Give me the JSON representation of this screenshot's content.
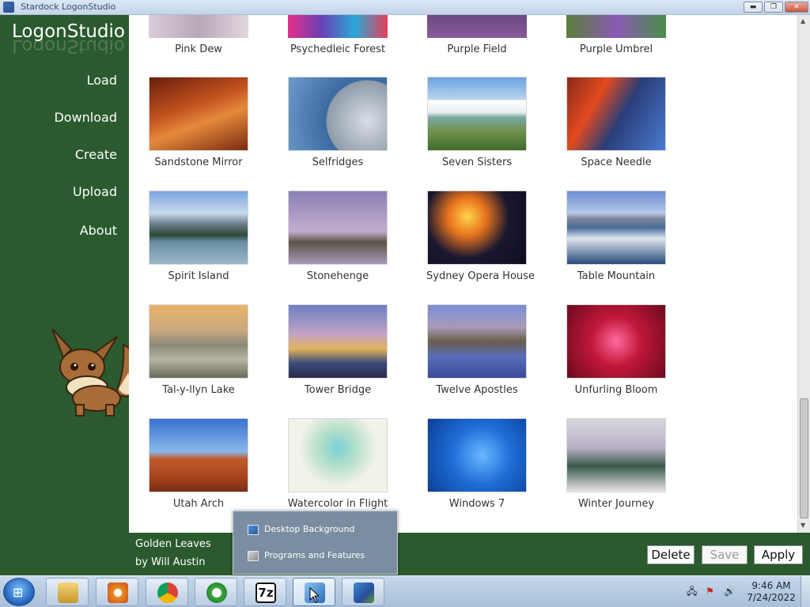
{
  "window": {
    "title": "Stardock LogonStudio",
    "min": "▬",
    "max": "❐",
    "close": "✕"
  },
  "sidebar": {
    "app_title": "LogonStudio",
    "nav": [
      {
        "label": "Load"
      },
      {
        "label": "Download"
      },
      {
        "label": "Create"
      },
      {
        "label": "Upload"
      },
      {
        "label": "About"
      }
    ]
  },
  "gallery": {
    "top_row": [
      {
        "label": "Pink Dew"
      },
      {
        "label": "Psychedleic Forest"
      },
      {
        "label": "Purple Field"
      },
      {
        "label": "Purple Umbrel"
      }
    ],
    "rows": [
      [
        {
          "label": "Sandstone Mirror"
        },
        {
          "label": "Selfridges"
        },
        {
          "label": "Seven Sisters"
        },
        {
          "label": "Space Needle"
        }
      ],
      [
        {
          "label": "Spirit Island"
        },
        {
          "label": "Stonehenge"
        },
        {
          "label": "Sydney Opera House"
        },
        {
          "label": "Table Mountain"
        }
      ],
      [
        {
          "label": "Tal-y-llyn Lake"
        },
        {
          "label": "Tower Bridge"
        },
        {
          "label": "Twelve Apostles"
        },
        {
          "label": "Unfurling Bloom"
        }
      ],
      [
        {
          "label": "Utah Arch"
        },
        {
          "label": "Watercolor in Flight"
        },
        {
          "label": "Windows 7"
        },
        {
          "label": "Winter Journey"
        }
      ]
    ]
  },
  "selection": {
    "name": "Golden Leaves",
    "author": "by Will Austin"
  },
  "buttons": {
    "delete": "Delete",
    "save": "Save",
    "apply": "Apply"
  },
  "popup": {
    "items": [
      {
        "label": "Desktop Background"
      },
      {
        "label": "Programs and Features"
      }
    ]
  },
  "taskbar": {
    "clock_time": "9:46 AM",
    "clock_date": "7/24/2022",
    "sevenzip_label": "7z"
  }
}
